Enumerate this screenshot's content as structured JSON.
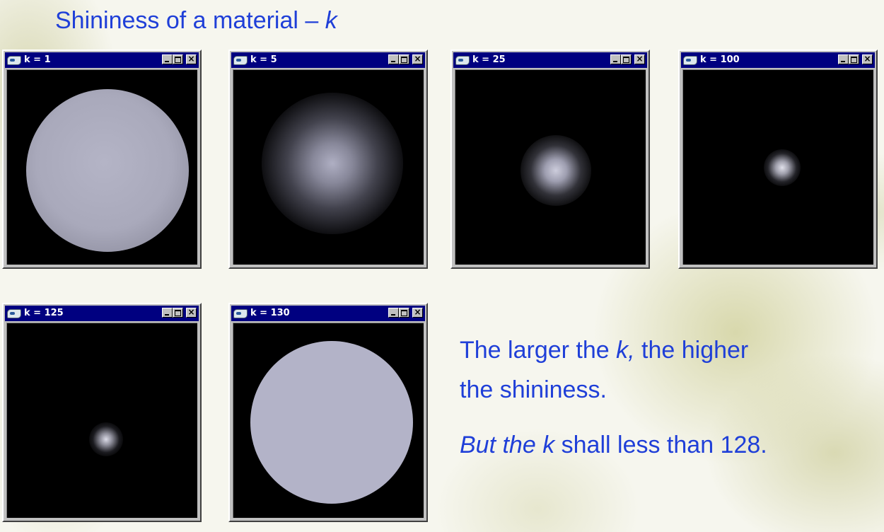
{
  "slide": {
    "title_prefix": "Shininess of a material – ",
    "title_var": "k",
    "caption1_pre": " The larger the ",
    "caption1_var": "k,",
    "caption1_post": " the higher",
    "caption2": "the shininess.",
    "caption3_pre": "But the k",
    "caption3_post": " shall less than 128."
  },
  "windows": [
    {
      "title": "k = 1",
      "k": 1
    },
    {
      "title": "k = 5",
      "k": 5
    },
    {
      "title": "k = 25",
      "k": 25
    },
    {
      "title": "k = 100",
      "k": 100
    },
    {
      "title": "k = 125",
      "k": 125
    },
    {
      "title": "k = 130",
      "k": 130
    }
  ],
  "colors": {
    "text": "#1f3fd8",
    "titlebar": "#000080",
    "sphere": "#b3b3c8"
  },
  "icons": {
    "app": "opengl-app-icon",
    "minimize": "minimize-icon",
    "maximize": "maximize-icon",
    "close": "close-icon"
  }
}
